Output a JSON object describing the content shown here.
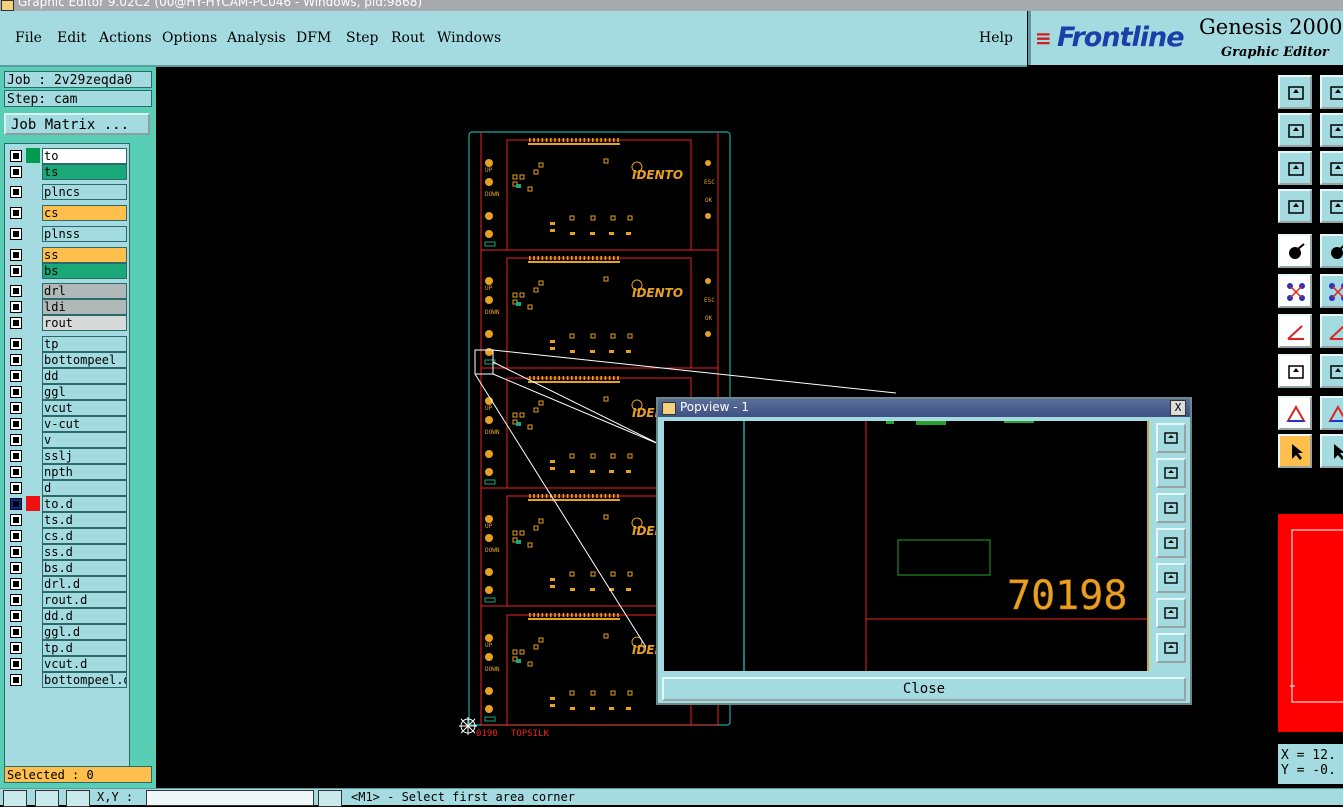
{
  "window": {
    "title": "Graphic Editor 9.02C2 (00@HY-HYCAM-PC046 - Windows, pid:9868)"
  },
  "menu": {
    "file": "File",
    "edit": "Edit",
    "actions": "Actions",
    "options": "Options",
    "analysis": "Analysis",
    "dfm": "DFM",
    "step": "Step",
    "rout": "Rout",
    "windows": "Windows",
    "help": "Help"
  },
  "logo": {
    "brand": "Frontline",
    "product": "Genesis 2000",
    "subtitle": "Graphic Editor"
  },
  "job": {
    "label": "Job : 2v29zeqda0",
    "step": "Step: cam",
    "matrix_button": "Job Matrix ..."
  },
  "layers": [
    {
      "name": "to",
      "bg": "#ffffff",
      "swatch": "#009a50"
    },
    {
      "name": "ts",
      "bg": "#1aa878",
      "swatch": ""
    },
    {
      "name": "plncs",
      "bg": "#a4dbe0",
      "swatch": ""
    },
    {
      "name": "cs",
      "bg": "#ffbf4d",
      "swatch": ""
    },
    {
      "name": "plnss",
      "bg": "#a4dbe0",
      "swatch": ""
    },
    {
      "name": "ss",
      "bg": "#ffbf4d",
      "swatch": ""
    },
    {
      "name": "bs",
      "bg": "#1aa878",
      "swatch": ""
    },
    {
      "name": "drl",
      "bg": "#b0b8b8",
      "swatch": ""
    },
    {
      "name": "ldi",
      "bg": "#b0b8b8",
      "swatch": ""
    },
    {
      "name": "rout",
      "bg": "#d8dada",
      "swatch": ""
    },
    {
      "name": "tp",
      "bg": "#a4dbe0",
      "swatch": ""
    },
    {
      "name": "bottompeel",
      "bg": "#a4dbe0",
      "swatch": ""
    },
    {
      "name": "dd",
      "bg": "#a4dbe0",
      "swatch": ""
    },
    {
      "name": "ggl",
      "bg": "#a4dbe0",
      "swatch": ""
    },
    {
      "name": "vcut",
      "bg": "#a4dbe0",
      "swatch": ""
    },
    {
      "name": "v-cut",
      "bg": "#a4dbe0",
      "swatch": ""
    },
    {
      "name": "v",
      "bg": "#a4dbe0",
      "swatch": ""
    },
    {
      "name": "sslj",
      "bg": "#a4dbe0",
      "swatch": ""
    },
    {
      "name": "npth",
      "bg": "#a4dbe0",
      "swatch": ""
    },
    {
      "name": "d",
      "bg": "#a4dbe0",
      "swatch": ""
    },
    {
      "name": "to.d",
      "bg": "#a4dbe0",
      "swatch": "#ee1111"
    },
    {
      "name": "ts.d",
      "bg": "#a4dbe0",
      "swatch": ""
    },
    {
      "name": "cs.d",
      "bg": "#a4dbe0",
      "swatch": ""
    },
    {
      "name": "ss.d",
      "bg": "#a4dbe0",
      "swatch": ""
    },
    {
      "name": "bs.d",
      "bg": "#a4dbe0",
      "swatch": ""
    },
    {
      "name": "drl.d",
      "bg": "#a4dbe0",
      "swatch": ""
    },
    {
      "name": "rout.d",
      "bg": "#a4dbe0",
      "swatch": ""
    },
    {
      "name": "dd.d",
      "bg": "#a4dbe0",
      "swatch": ""
    },
    {
      "name": "ggl.d",
      "bg": "#a4dbe0",
      "swatch": ""
    },
    {
      "name": "tp.d",
      "bg": "#a4dbe0",
      "swatch": ""
    },
    {
      "name": "vcut.d",
      "bg": "#a4dbe0",
      "swatch": ""
    },
    {
      "name": "bottompeel.d",
      "bg": "#a4dbe0",
      "swatch": ""
    }
  ],
  "selected": "Selected : 0",
  "board": {
    "brand": "IDENTO",
    "label": "TOPSILK",
    "code": "0190",
    "marks": {
      "down": "DOWN",
      "up": "UP",
      "esc": "ESC",
      "ok": "OK"
    }
  },
  "popview": {
    "title": "Popview - 1",
    "close_button": "Close",
    "close_x": "X",
    "number": "70198"
  },
  "coords": {
    "x": "X = 12.",
    "y": "Y = -0."
  },
  "status": {
    "xy_label": "X,Y :",
    "prompt": "<M1> - Select first area corner"
  }
}
